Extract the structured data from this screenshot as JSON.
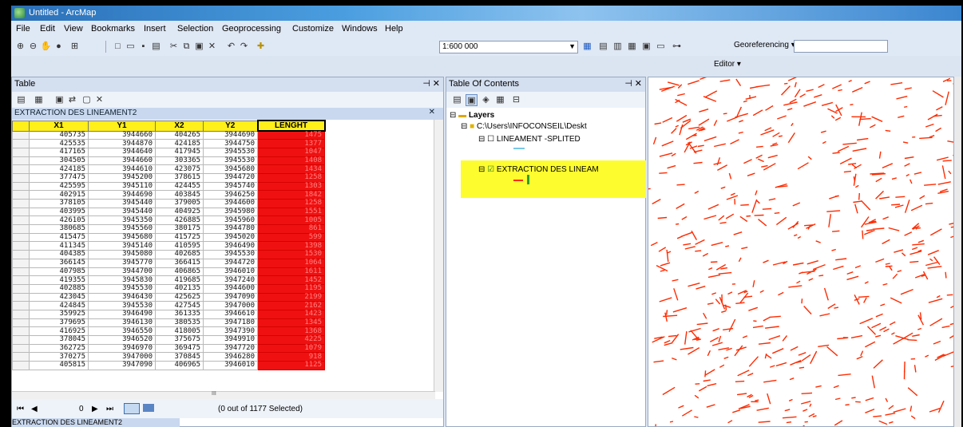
{
  "window": {
    "title": "Untitled - ArcMap"
  },
  "menu": [
    "File",
    "Edit",
    "View",
    "Bookmarks",
    "Insert",
    "Selection",
    "Geoprocessing",
    "Customize",
    "Windows",
    "Help"
  ],
  "toolbar": {
    "scale": "1:600 000",
    "georeferencing": "Georeferencing",
    "editor": "Editor"
  },
  "table_panel": {
    "title": "Table",
    "tab": "EXTRACTION DES LINEAMENT2",
    "columns": [
      "X1",
      "Y1",
      "X2",
      "Y2",
      "LENGHT"
    ],
    "rows": [
      [
        "405735",
        "3944660",
        "404265",
        "3944690",
        "1475"
      ],
      [
        "425535",
        "3944870",
        "424185",
        "3944750",
        "1377"
      ],
      [
        "417165",
        "3944640",
        "417945",
        "3945530",
        "1047"
      ],
      [
        "304505",
        "3944660",
        "303365",
        "3945530",
        "1408"
      ],
      [
        "424185",
        "3944610",
        "423075",
        "3945680",
        "1434"
      ],
      [
        "377475",
        "3945200",
        "378615",
        "3944720",
        "1258"
      ],
      [
        "425595",
        "3945110",
        "424455",
        "3945740",
        "1303"
      ],
      [
        "402915",
        "3944690",
        "403845",
        "3946250",
        "1842"
      ],
      [
        "378105",
        "3945440",
        "379005",
        "3944600",
        "1258"
      ],
      [
        "403995",
        "3945440",
        "404925",
        "3945980",
        "1551"
      ],
      [
        "426105",
        "3945350",
        "426885",
        "3945960",
        "1005"
      ],
      [
        "380685",
        "3945560",
        "380175",
        "3944780",
        "861"
      ],
      [
        "415475",
        "3945680",
        "415725",
        "3945020",
        "599"
      ],
      [
        "411345",
        "3945140",
        "410595",
        "3946490",
        "1398"
      ],
      [
        "404385",
        "3945080",
        "402685",
        "3945530",
        "1530"
      ],
      [
        "366145",
        "3945770",
        "366415",
        "3944720",
        "1064"
      ],
      [
        "407985",
        "3944700",
        "406865",
        "3946010",
        "1611"
      ],
      [
        "419355",
        "3945830",
        "419685",
        "3947240",
        "1452"
      ],
      [
        "402885",
        "3945530",
        "402135",
        "3944600",
        "1195"
      ],
      [
        "423045",
        "3946430",
        "425625",
        "3947090",
        "2199"
      ],
      [
        "424845",
        "3945530",
        "427545",
        "3947000",
        "2162"
      ],
      [
        "359925",
        "3946490",
        "361335",
        "3946610",
        "1423"
      ],
      [
        "379695",
        "3946130",
        "380535",
        "3947180",
        "1345"
      ],
      [
        "416925",
        "3946550",
        "418005",
        "3947390",
        "1368"
      ],
      [
        "378045",
        "3946520",
        "375675",
        "3949910",
        "4225"
      ],
      [
        "362725",
        "3946970",
        "369475",
        "3947720",
        "1079"
      ],
      [
        "370275",
        "3947000",
        "370845",
        "3946280",
        "918"
      ],
      [
        "405815",
        "3947090",
        "406965",
        "3946010",
        "1125"
      ]
    ],
    "scroll_marker": "III",
    "record_nav": "0",
    "selection_status": "(0 out of 1177 Selected)",
    "bottom_tab": "EXTRACTION DES LINEAMENT2"
  },
  "toc": {
    "title": "Table Of Contents",
    "layers_label": "Layers",
    "folder_path": "C:\\Users\\INFOCONSEIL\\Deskt",
    "layer1": "LINEAMENT -SPLITED",
    "layer2": "EXTRACTION DES LINEAM"
  },
  "colors": {
    "lineament": "#ff2a00",
    "highlight": "#fdfc2f",
    "length_cell": "#ef1111",
    "header": "#ffef1a"
  }
}
